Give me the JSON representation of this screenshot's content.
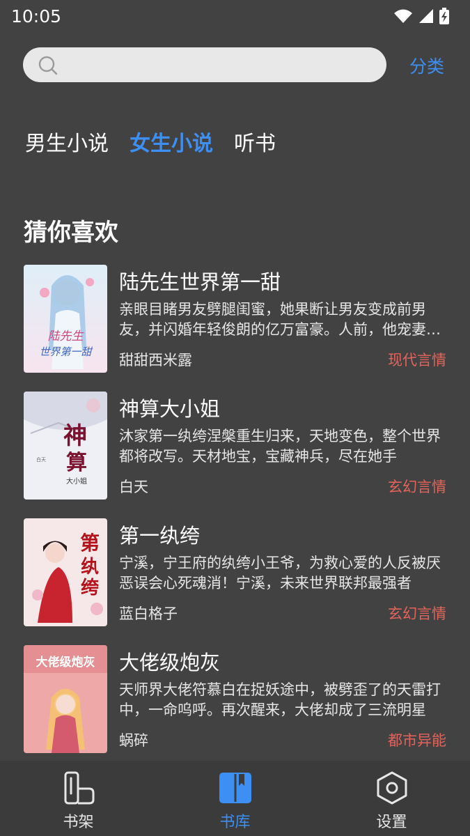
{
  "status_bar": {
    "time": "10:05"
  },
  "search": {
    "placeholder": "",
    "category_label": "分类"
  },
  "tabs": [
    {
      "label": "男生小说",
      "active": false
    },
    {
      "label": "女生小说",
      "active": true
    },
    {
      "label": "听书",
      "active": false
    }
  ],
  "section": {
    "title": "猜你喜欢"
  },
  "books": [
    {
      "title": "陆先生世界第一甜",
      "description": "亲眼目睹男友劈腿闺蜜，她果断让男友变成前男友，并闪婚年轻俊朗的亿万富豪。人前，他宠妻入骨",
      "author": "甜甜西米露",
      "genre": "现代言情",
      "cover_text": "陆先生世界第一甜"
    },
    {
      "title": "神算大小姐",
      "description": "沐家第一纨绔涅槃重生归来，天地变色，整个世界都将改写。天材地宝，宝藏神兵，尽在她手",
      "author": "白天",
      "genre": "玄幻言情",
      "cover_text": "神算大小姐"
    },
    {
      "title": "第一纨绔",
      "description": "宁溪，宁王府的纨绔小王爷，为救心爱的人反被厌恶误会心死魂消！宁溪，未来世界联邦最强者",
      "author": "蓝白格子",
      "genre": "玄幻言情",
      "cover_text": "第一纨绔"
    },
    {
      "title": "大佬级炮灰",
      "description": "天师界大佬符慕白在捉妖途中，被劈歪了的天雷打中，一命呜呼。再次醒来，大佬却成了三流明星",
      "author": "蜗碎",
      "genre": "都市异能",
      "cover_text": "大佬级炮灰"
    }
  ],
  "bottom_nav": [
    {
      "label": "书架",
      "icon": "bookshelf-icon",
      "active": false
    },
    {
      "label": "书库",
      "icon": "library-book-icon",
      "active": true
    },
    {
      "label": "设置",
      "icon": "settings-hexagon-icon",
      "active": false
    }
  ],
  "colors": {
    "background": "#424242",
    "accent": "#3d8ff3",
    "genre": "#e4645b",
    "search_bg": "#e8e8e8",
    "nav_bg": "#3b3b3b"
  }
}
